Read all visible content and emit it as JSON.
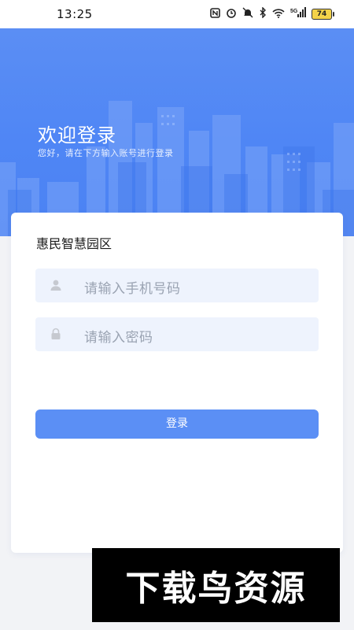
{
  "status_bar": {
    "time": "13:25",
    "icons": [
      "nfc-icon",
      "alarm-icon",
      "mute-icon",
      "bluetooth-icon",
      "wifi-icon",
      "signal-icon"
    ],
    "signal_label": "5G",
    "battery": "74"
  },
  "hero": {
    "title": "欢迎登录",
    "subtitle": "您好，请在下方输入账号进行登录",
    "colors": {
      "top": "#5b8ef4",
      "bottom": "#4b82f3"
    }
  },
  "card": {
    "app_name": "惠民智慧园区",
    "phone_placeholder": "请输入手机号码",
    "password_placeholder": "请输入密码",
    "login_label": "登录"
  },
  "watermark": {
    "text": "下载鸟资源"
  },
  "colors": {
    "accent": "#5b8ff5",
    "field_bg": "#eef3fd"
  }
}
